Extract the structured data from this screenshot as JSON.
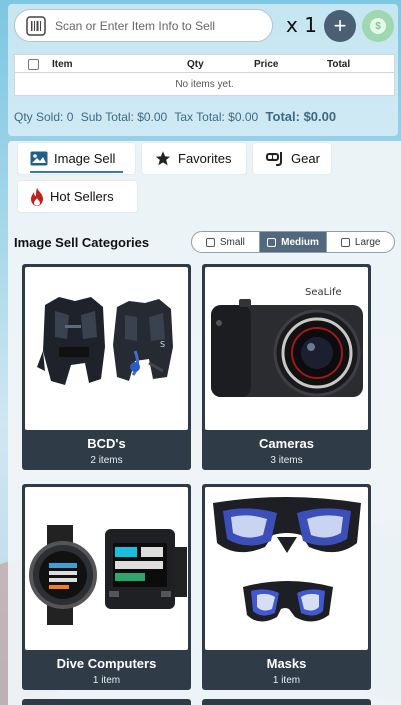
{
  "scan": {
    "placeholder": "Scan or Enter Item Info to Sell",
    "quantity": "x 1"
  },
  "buttons": {
    "add": "+",
    "pay": "$"
  },
  "table": {
    "headers": [
      "Item",
      "Qty",
      "Price",
      "Total"
    ],
    "empty": "No items yet."
  },
  "totals": {
    "qty_sold": "Qty Sold: 0",
    "sub_total": "Sub Total: $0.00",
    "tax_total": "Tax Total: $0.00",
    "grand_total": "Total: $0.00"
  },
  "tabs": [
    {
      "label": "Image Sell",
      "icon": "image-icon",
      "active": true
    },
    {
      "label": "Favorites",
      "icon": "star-icon",
      "active": false
    },
    {
      "label": "Gear",
      "icon": "gear-diving-icon",
      "active": false
    },
    {
      "label": "Hot Sellers",
      "icon": "flame-icon",
      "active": false
    }
  ],
  "categories_title": "Image Sell Categories",
  "size_options": [
    {
      "label": "Small",
      "selected": false
    },
    {
      "label": "Medium",
      "selected": true
    },
    {
      "label": "Large",
      "selected": false
    }
  ],
  "categories": [
    {
      "name": "BCD's",
      "count": "2 items",
      "image": "bcd-vests"
    },
    {
      "name": "Cameras",
      "count": "3 items",
      "image": "camera"
    },
    {
      "name": "Dive Computers",
      "count": "1 item",
      "image": "dive-computers"
    },
    {
      "name": "Masks",
      "count": "1 item",
      "image": "dive-masks"
    }
  ],
  "camera_brand": "SeaLife",
  "colors": {
    "accent": "#3a7ca5",
    "card_bg": "#2f3b46",
    "totals_text": "#3d6a85",
    "add_button": "#4a5f73",
    "pay_button": "#9fd7b0"
  }
}
